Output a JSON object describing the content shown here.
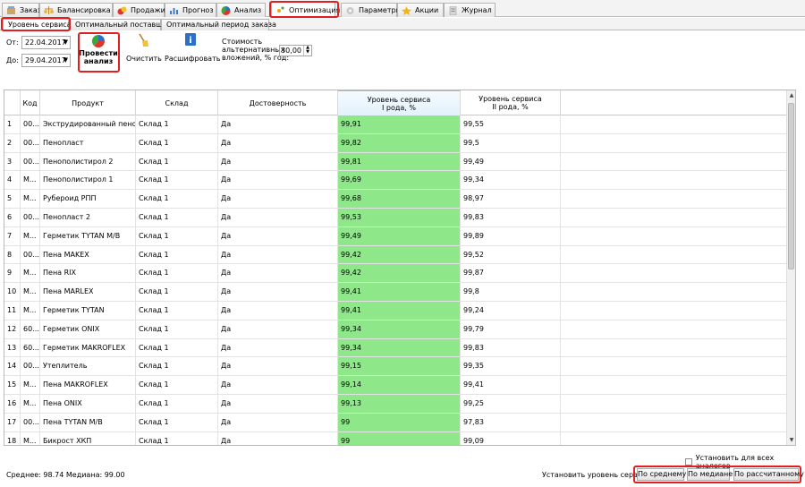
{
  "tabs": [
    {
      "label": "Заказ",
      "icon": "order-icon"
    },
    {
      "label": "Балансировка",
      "icon": "balance-icon"
    },
    {
      "label": "Продажи",
      "icon": "sales-icon"
    },
    {
      "label": "Прогноз",
      "icon": "forecast-icon"
    },
    {
      "label": "Анализ",
      "icon": "analysis-icon"
    },
    {
      "label": "Оптимизация",
      "icon": "optimization-icon"
    },
    {
      "label": "Параметры",
      "icon": "parameters-icon"
    },
    {
      "label": "Акции",
      "icon": "promotions-icon"
    },
    {
      "label": "Журнал",
      "icon": "journal-icon"
    }
  ],
  "active_tab": "Оптимизация",
  "subtabs": [
    "Уровень сервиса",
    "Оптимальный поставщик",
    "Оптимальный период заказа"
  ],
  "toolbar": {
    "from_label": "От:",
    "from_date": "22.04.2017",
    "to_label": "До:",
    "to_date": "29.04.2017",
    "run_label_1": "Провести",
    "run_label_2": "анализ",
    "clear_label": "Очистить",
    "decode_label": "Расшифровать",
    "cost_label_1": "Стоимость",
    "cost_label_2": "альтернативных",
    "cost_label_3": "вложений, % год:",
    "cost_value": "30,00"
  },
  "grid": {
    "headers": {
      "code": "Код",
      "product": "Продукт",
      "warehouse": "Склад",
      "reliability": "Достоверность",
      "level1_line1": "Уровень сервиса",
      "level1_line2": "I рода, %",
      "level2_line1": "Уровень сервиса",
      "level2_line2": "II рода, %"
    },
    "rows": [
      {
        "n": "1",
        "code": "00...",
        "product": "Экструдированный пено...",
        "warehouse": "Склад 1",
        "reliability": "Да",
        "l1": "99,91",
        "l2": "99,55"
      },
      {
        "n": "2",
        "code": "00...",
        "product": "Пенопласт",
        "warehouse": "Склад 1",
        "reliability": "Да",
        "l1": "99,82",
        "l2": "99,5"
      },
      {
        "n": "3",
        "code": "00...",
        "product": "Пенополистирол 2",
        "warehouse": "Склад 1",
        "reliability": "Да",
        "l1": "99,81",
        "l2": "99,49"
      },
      {
        "n": "4",
        "code": "М...",
        "product": "Пенополистирол 1",
        "warehouse": "Склад 1",
        "reliability": "Да",
        "l1": "99,69",
        "l2": "99,34"
      },
      {
        "n": "5",
        "code": "М...",
        "product": "Рубероид РПП",
        "warehouse": "Склад 1",
        "reliability": "Да",
        "l1": "99,68",
        "l2": "98,97"
      },
      {
        "n": "6",
        "code": "00...",
        "product": "Пенопласт 2",
        "warehouse": "Склад 1",
        "reliability": "Да",
        "l1": "99,53",
        "l2": "99,83"
      },
      {
        "n": "7",
        "code": "М...",
        "product": "Герметик TYTAN M/B",
        "warehouse": "Склад 1",
        "reliability": "Да",
        "l1": "99,49",
        "l2": "99,89"
      },
      {
        "n": "8",
        "code": "00...",
        "product": "Пена MAKEX",
        "warehouse": "Склад 1",
        "reliability": "Да",
        "l1": "99,42",
        "l2": "99,52"
      },
      {
        "n": "9",
        "code": "М...",
        "product": "Пена RIX",
        "warehouse": "Склад 1",
        "reliability": "Да",
        "l1": "99,42",
        "l2": "99,87"
      },
      {
        "n": "10",
        "code": "М...",
        "product": "Пена MARLEX",
        "warehouse": "Склад 1",
        "reliability": "Да",
        "l1": "99,41",
        "l2": "99,8"
      },
      {
        "n": "11",
        "code": "М...",
        "product": "Герметик TYTAN",
        "warehouse": "Склад 1",
        "reliability": "Да",
        "l1": "99,41",
        "l2": "99,24"
      },
      {
        "n": "12",
        "code": "60...",
        "product": "Герметик ONIX",
        "warehouse": "Склад 1",
        "reliability": "Да",
        "l1": "99,34",
        "l2": "99,79"
      },
      {
        "n": "13",
        "code": "60...",
        "product": "Герметик MAKROFLEX",
        "warehouse": "Склад 1",
        "reliability": "Да",
        "l1": "99,34",
        "l2": "99,83"
      },
      {
        "n": "14",
        "code": "00...",
        "product": "Утеплитель",
        "warehouse": "Склад 1",
        "reliability": "Да",
        "l1": "99,15",
        "l2": "99,35"
      },
      {
        "n": "15",
        "code": "М...",
        "product": "Пена MAKROFLEX",
        "warehouse": "Склад 1",
        "reliability": "Да",
        "l1": "99,14",
        "l2": "99,41"
      },
      {
        "n": "16",
        "code": "М...",
        "product": "Пена ONIX",
        "warehouse": "Склад 1",
        "reliability": "Да",
        "l1": "99,13",
        "l2": "99,25"
      },
      {
        "n": "17",
        "code": "00...",
        "product": "Пена TYTAN M/B",
        "warehouse": "Склад 1",
        "reliability": "Да",
        "l1": "99",
        "l2": "97,83"
      },
      {
        "n": "18",
        "code": "М...",
        "product": "Бикрост ХКП",
        "warehouse": "Склад 1",
        "reliability": "Да",
        "l1": "99",
        "l2": "99,09"
      }
    ]
  },
  "bottom": {
    "install_all_label": "Установить для всех аналогов",
    "stats": "Среднее: 98.74 Медиана: 99.00",
    "set_level_label": "Установить уровень сервиса",
    "btn_average": "По среднему",
    "btn_median": "По медиане",
    "btn_calculated": "По рассчитанному"
  },
  "colors": {
    "highlight_green": "#8ee88a",
    "annotation_red": "#e02020"
  }
}
